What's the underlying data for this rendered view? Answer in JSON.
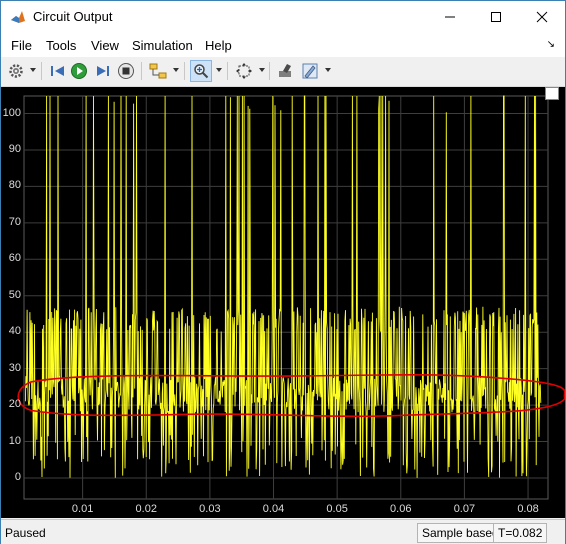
{
  "window": {
    "title": "Circuit Output",
    "controls": [
      "minimize-icon",
      "maximize-icon",
      "close-icon"
    ]
  },
  "menu": {
    "items": [
      "File",
      "Tools",
      "View",
      "Simulation",
      "Help"
    ]
  },
  "toolbar": {
    "icons": [
      "gear-icon",
      "step-back-icon",
      "run-icon",
      "step-forward-icon",
      "stop-icon",
      "signal-select-icon",
      "zoom-icon",
      "fit-to-view-icon",
      "style-icon",
      "highlight-icon"
    ]
  },
  "plot": {
    "background": "#000000",
    "trace_color": "#ffff00",
    "annotation_color": "#e00000",
    "yticks": [
      "0",
      "10",
      "20",
      "30",
      "40",
      "50",
      "60",
      "70",
      "80",
      "90",
      "100"
    ],
    "xticks": [
      "0.01",
      "0.02",
      "0.03",
      "0.04",
      "0.05",
      "0.06",
      "0.07",
      "0.08"
    ]
  },
  "chart_data": {
    "type": "line",
    "xlim": [
      0.001,
      0.082
    ],
    "ylim": [
      -5,
      102
    ],
    "grid": true,
    "series_summary": "dense noisy signal, baseline ~20-25, frequent spikes to ~45 and occasional spikes above 100",
    "band_annotation": {
      "y_low": 18,
      "y_high": 28
    }
  },
  "status": {
    "state": "Paused",
    "sample_mode": "Sample based",
    "time": "T=0.082"
  }
}
